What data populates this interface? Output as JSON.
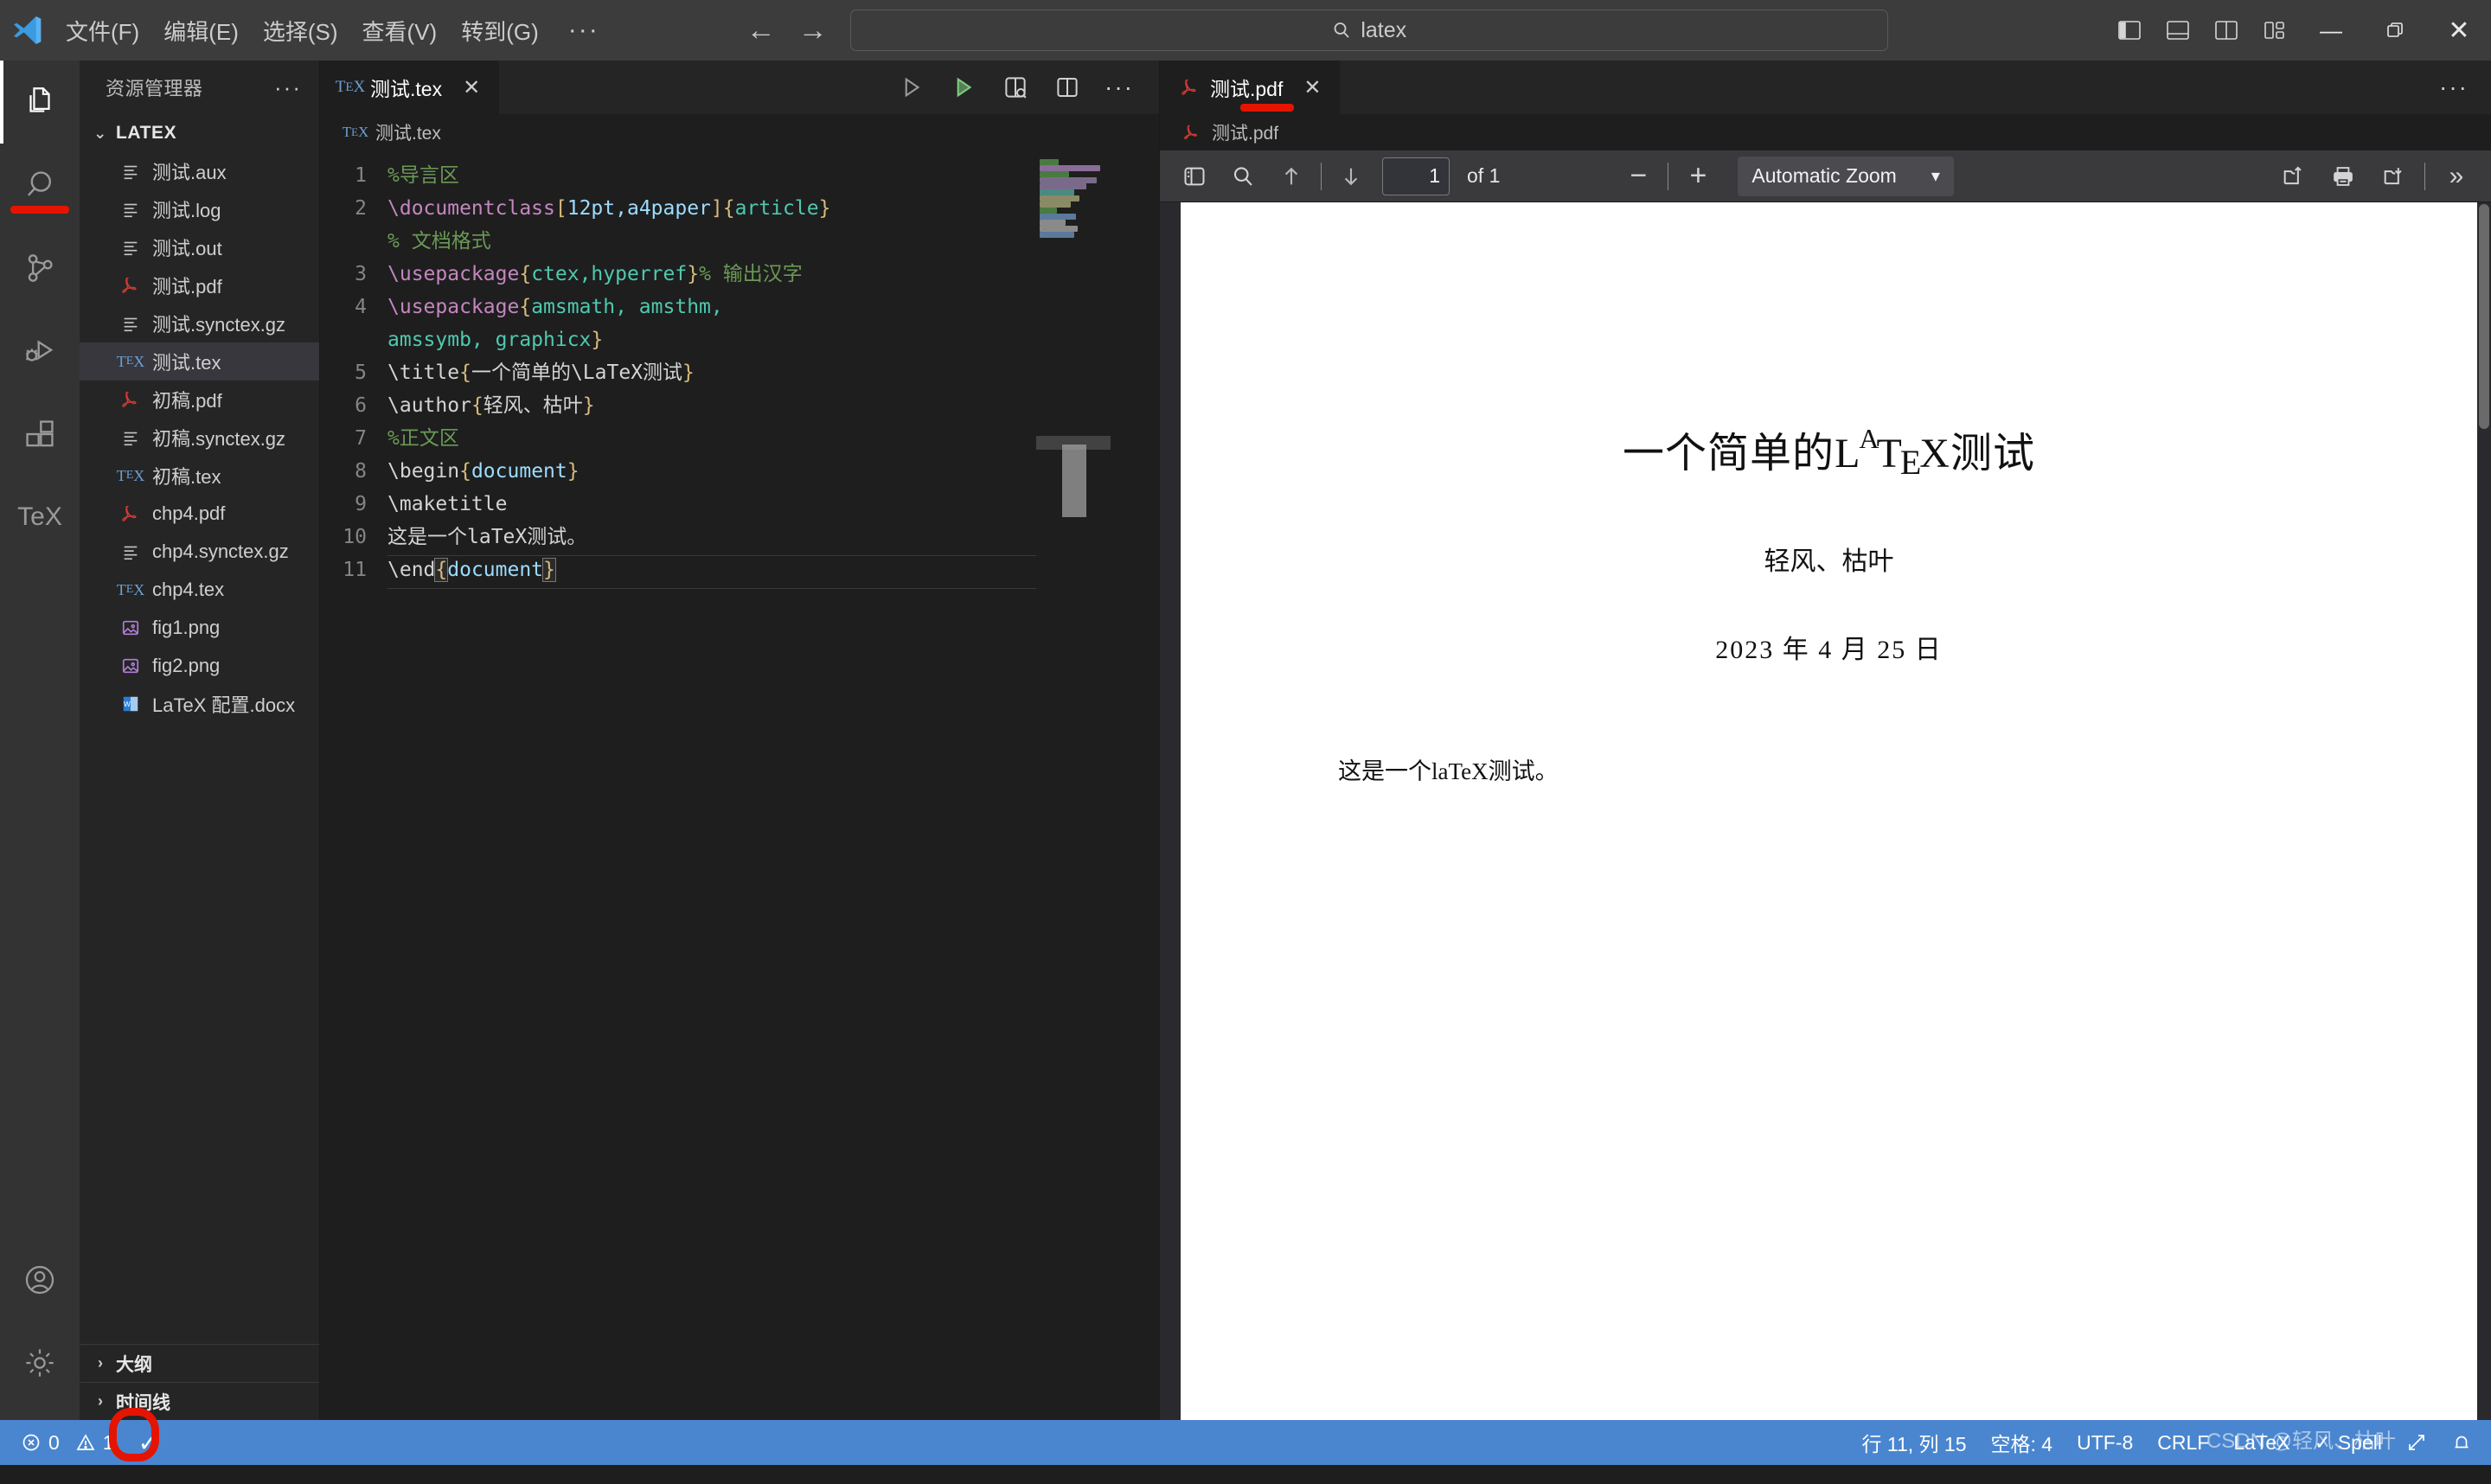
{
  "titlebar": {
    "logo": "vscode-logo",
    "menus": [
      "文件(F)",
      "编辑(E)",
      "选择(S)",
      "查看(V)",
      "转到(G)",
      "···"
    ],
    "back_icon": "←",
    "forward_icon": "→",
    "search_value": "latex",
    "search_icon": "search-icon",
    "layout_buttons": [
      "toggle-primary-sidebar",
      "toggle-panel",
      "toggle-secondary-sidebar",
      "customize-layout"
    ],
    "window_controls": {
      "minimize": "—",
      "restore": "restore-icon",
      "close": "✕"
    }
  },
  "activitybar": {
    "items": [
      {
        "name": "explorer",
        "icon": "files-icon",
        "active": true
      },
      {
        "name": "search",
        "icon": "search-icon",
        "active": false
      },
      {
        "name": "source-control",
        "icon": "source-control-icon",
        "active": false
      },
      {
        "name": "run-and-debug",
        "icon": "debug-icon",
        "active": false
      },
      {
        "name": "extensions",
        "icon": "extensions-icon",
        "active": false
      },
      {
        "name": "latex-workshop",
        "icon": "tex-icon",
        "label": "TeX",
        "active": false
      }
    ],
    "bottom": [
      {
        "name": "accounts",
        "icon": "account-icon"
      },
      {
        "name": "manage",
        "icon": "gear-icon"
      }
    ],
    "annotation_color": "#e51400"
  },
  "sidebar": {
    "title": "资源管理器",
    "more_actions": "···",
    "root_folder": "LATEX",
    "root_expanded": true,
    "files": [
      {
        "name": "测试.aux",
        "icon": "text-file-icon",
        "selected": false
      },
      {
        "name": "测试.log",
        "icon": "text-file-icon",
        "selected": false
      },
      {
        "name": "测试.out",
        "icon": "text-file-icon",
        "selected": false
      },
      {
        "name": "测试.pdf",
        "icon": "pdf-icon",
        "selected": false
      },
      {
        "name": "测试.synctex.gz",
        "icon": "text-file-icon",
        "selected": false
      },
      {
        "name": "测试.tex",
        "icon": "tex-icon",
        "selected": true
      },
      {
        "name": "初稿.pdf",
        "icon": "pdf-icon",
        "selected": false
      },
      {
        "name": "初稿.synctex.gz",
        "icon": "text-file-icon",
        "selected": false
      },
      {
        "name": "初稿.tex",
        "icon": "tex-icon",
        "selected": false
      },
      {
        "name": "chp4.pdf",
        "icon": "pdf-icon",
        "selected": false
      },
      {
        "name": "chp4.synctex.gz",
        "icon": "text-file-icon",
        "selected": false
      },
      {
        "name": "chp4.tex",
        "icon": "tex-icon",
        "selected": false
      },
      {
        "name": "fig1.png",
        "icon": "image-icon",
        "selected": false
      },
      {
        "name": "fig2.png",
        "icon": "image-icon",
        "selected": false
      },
      {
        "name": "LaTeX 配置.docx",
        "icon": "word-icon",
        "selected": false
      }
    ],
    "collapsed_panels": [
      {
        "label": "大纲"
      },
      {
        "label": "时间线"
      }
    ]
  },
  "editor": {
    "tab": {
      "label": "测试.tex",
      "icon": "tex-icon",
      "close": "✕"
    },
    "breadcrumb": {
      "label": "测试.tex",
      "icon": "tex-icon"
    },
    "actions": [
      "build-latex-project",
      "recipe-build",
      "view-latex-pdf",
      "split-editor",
      "more-actions"
    ],
    "lines": [
      {
        "num": "1",
        "segments": [
          {
            "t": "%导言区",
            "c": "c-comment"
          }
        ]
      },
      {
        "num": "2",
        "segments": [
          {
            "t": "\\documentclass",
            "c": "c-cmd"
          },
          {
            "t": "[",
            "c": "c-bracket"
          },
          {
            "t": "12pt,a4paper",
            "c": "c-opt"
          },
          {
            "t": "]",
            "c": "c-bracket"
          },
          {
            "t": "{",
            "c": "c-brace"
          },
          {
            "t": "article",
            "c": "c-arg"
          },
          {
            "t": "}",
            "c": "c-brace"
          }
        ]
      },
      {
        "num": "",
        "segments": [
          {
            "t": "% 文档格式",
            "c": "c-comment"
          }
        ]
      },
      {
        "num": "3",
        "segments": [
          {
            "t": "\\usepackage",
            "c": "c-cmd"
          },
          {
            "t": "{",
            "c": "c-brace"
          },
          {
            "t": "ctex,hyperref",
            "c": "c-arg"
          },
          {
            "t": "}",
            "c": "c-brace"
          },
          {
            "t": "% 输出汉字",
            "c": "c-comment"
          }
        ]
      },
      {
        "num": "4",
        "segments": [
          {
            "t": "\\usepackage",
            "c": "c-cmd"
          },
          {
            "t": "{",
            "c": "c-brace"
          },
          {
            "t": "amsmath, amsthm,",
            "c": "c-arg"
          }
        ]
      },
      {
        "num": "",
        "segments": [
          {
            "t": "amssymb, graphicx",
            "c": "c-arg"
          },
          {
            "t": "}",
            "c": "c-brace"
          }
        ]
      },
      {
        "num": "5",
        "segments": [
          {
            "t": "\\title",
            "c": "c-text"
          },
          {
            "t": "{",
            "c": "c-brace"
          },
          {
            "t": "一个简单的\\LaTeX测试",
            "c": "c-text"
          },
          {
            "t": "}",
            "c": "c-brace"
          }
        ]
      },
      {
        "num": "6",
        "segments": [
          {
            "t": "\\author",
            "c": "c-text"
          },
          {
            "t": "{",
            "c": "c-brace"
          },
          {
            "t": "轻风、枯叶",
            "c": "c-text"
          },
          {
            "t": "}",
            "c": "c-brace"
          }
        ]
      },
      {
        "num": "7",
        "segments": [
          {
            "t": "%正文区",
            "c": "c-comment"
          }
        ]
      },
      {
        "num": "8",
        "segments": [
          {
            "t": "\\begin",
            "c": "c-text"
          },
          {
            "t": "{",
            "c": "c-brace"
          },
          {
            "t": "document",
            "c": "c-blue"
          },
          {
            "t": "}",
            "c": "c-brace"
          }
        ]
      },
      {
        "num": "9",
        "segments": [
          {
            "t": "\\maketitle",
            "c": "c-text"
          }
        ]
      },
      {
        "num": "10",
        "segments": [
          {
            "t": "这是一个laTeX测试。",
            "c": "c-text"
          }
        ]
      },
      {
        "num": "11",
        "segments": [
          {
            "t": "\\end",
            "c": "c-text"
          },
          {
            "t": "{",
            "c": "c-brace"
          },
          {
            "t": "document",
            "c": "c-blue"
          },
          {
            "t": "}",
            "c": "c-brace"
          }
        ]
      }
    ]
  },
  "pdfviewer": {
    "tab": {
      "label": "测试.pdf",
      "icon": "pdf-icon",
      "close": "✕"
    },
    "breadcrumb": {
      "label": "测试.pdf",
      "icon": "pdf-icon"
    },
    "more_actions": "···",
    "toolbar": {
      "sidebar_toggle": "sidebar-toggle-icon",
      "find": "search-icon",
      "previous_page": "up-arrow-icon",
      "next_page": "down-arrow-icon",
      "page_number": "1",
      "page_count": "of 1",
      "zoom_out": "−",
      "zoom_in": "+",
      "zoom_level": "Automatic Zoom",
      "zoom_chevron": "chevron-down-icon",
      "open_file": "open-file-icon",
      "print": "print-icon",
      "save": "save-icon",
      "more_tools": "»"
    },
    "document": {
      "title_prefix": "一个简单的",
      "title_latex": "LaTeX",
      "title_suffix": "测试",
      "author": "轻风、枯叶",
      "date": "2023 年 4 月 25 日",
      "body": "这是一个laTeX测试。"
    }
  },
  "statusbar": {
    "errors_icon": "error-icon",
    "errors": "0",
    "warnings_icon": "warning-icon",
    "warnings": "1",
    "build_status_icon": "check-icon",
    "build_status": "✓",
    "line_col": "行 11, 列 15",
    "indent": "空格: 4",
    "encoding": "UTF-8",
    "eol": "CRLF",
    "language": "LaTeX",
    "spell_check_icon": "check-icon",
    "spell_check": "Spell",
    "remote_icon": "remote-icon",
    "bell_icon": "bell-icon",
    "background": "#4a86cf",
    "annotation_color": "#e51400",
    "watermark": "CSDN @轻风、枯叶"
  }
}
